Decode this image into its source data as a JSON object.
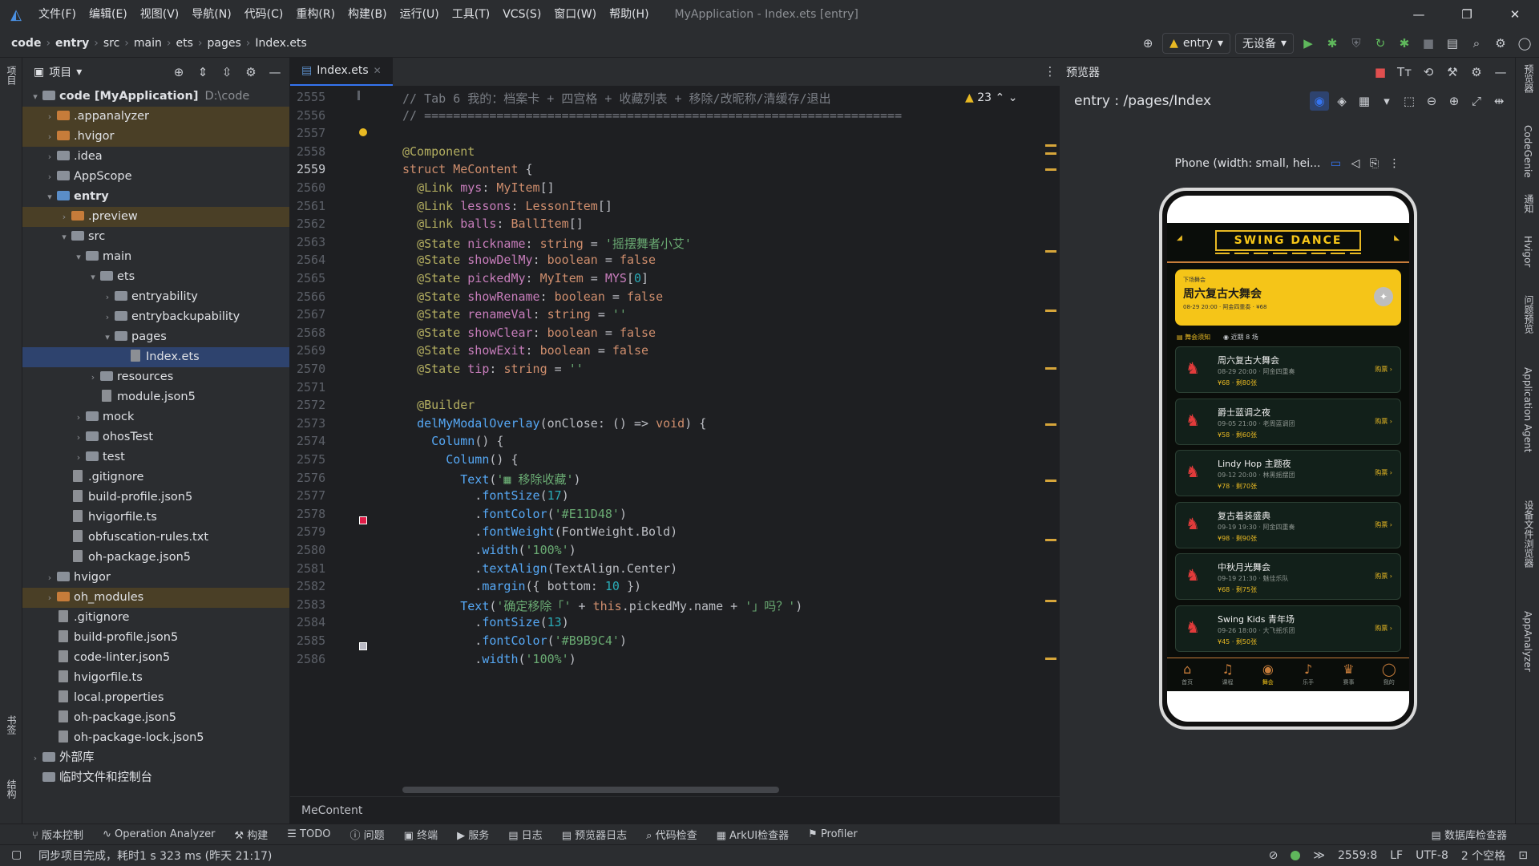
{
  "titlebar": {
    "menu": [
      "文件(F)",
      "编辑(E)",
      "视图(V)",
      "导航(N)",
      "代码(C)",
      "重构(R)",
      "构建(B)",
      "运行(U)",
      "工具(T)",
      "VCS(S)",
      "窗口(W)",
      "帮助(H)"
    ],
    "title": "MyApplication - Index.ets [entry]"
  },
  "nav": {
    "crumbs": [
      "code",
      "entry",
      "src",
      "main",
      "ets",
      "pages",
      "Index.ets"
    ],
    "module": "entry",
    "device": "无设备"
  },
  "leftstrip": {
    "project": "项目",
    "bookmarks": "书签",
    "structure": "结构"
  },
  "project": {
    "header": "项目",
    "tree": [
      {
        "d": 0,
        "arrow": "▾",
        "icon": "fold",
        "text": "code [MyApplication]",
        "extra": "D:\\code",
        "bold": true
      },
      {
        "d": 1,
        "arrow": "›",
        "icon": "or",
        "text": ".appanalyzer",
        "hl": true
      },
      {
        "d": 1,
        "arrow": "›",
        "icon": "or",
        "text": ".hvigor",
        "hl": true
      },
      {
        "d": 1,
        "arrow": "›",
        "icon": "fold",
        "text": ".idea"
      },
      {
        "d": 1,
        "arrow": "›",
        "icon": "fold",
        "text": "AppScope"
      },
      {
        "d": 1,
        "arrow": "▾",
        "icon": "bl",
        "text": "entry",
        "bold": true
      },
      {
        "d": 2,
        "arrow": "›",
        "icon": "or",
        "text": ".preview",
        "hl": true
      },
      {
        "d": 2,
        "arrow": "▾",
        "icon": "fold",
        "text": "src"
      },
      {
        "d": 3,
        "arrow": "▾",
        "icon": "fold",
        "text": "main"
      },
      {
        "d": 4,
        "arrow": "▾",
        "icon": "fold",
        "text": "ets"
      },
      {
        "d": 5,
        "arrow": "›",
        "icon": "fold",
        "text": "entryability"
      },
      {
        "d": 5,
        "arrow": "›",
        "icon": "fold",
        "text": "entrybackupability"
      },
      {
        "d": 5,
        "arrow": "▾",
        "icon": "fold",
        "text": "pages"
      },
      {
        "d": 6,
        "arrow": "",
        "icon": "file",
        "text": "Index.ets",
        "sel": true
      },
      {
        "d": 4,
        "arrow": "›",
        "icon": "fold",
        "text": "resources"
      },
      {
        "d": 4,
        "arrow": "",
        "icon": "file",
        "text": "module.json5"
      },
      {
        "d": 3,
        "arrow": "›",
        "icon": "fold",
        "text": "mock"
      },
      {
        "d": 3,
        "arrow": "›",
        "icon": "fold",
        "text": "ohosTest"
      },
      {
        "d": 3,
        "arrow": "›",
        "icon": "fold",
        "text": "test"
      },
      {
        "d": 2,
        "arrow": "",
        "icon": "file",
        "text": ".gitignore"
      },
      {
        "d": 2,
        "arrow": "",
        "icon": "file",
        "text": "build-profile.json5"
      },
      {
        "d": 2,
        "arrow": "",
        "icon": "file",
        "text": "hvigorfile.ts"
      },
      {
        "d": 2,
        "arrow": "",
        "icon": "file",
        "text": "obfuscation-rules.txt"
      },
      {
        "d": 2,
        "arrow": "",
        "icon": "file",
        "text": "oh-package.json5"
      },
      {
        "d": 1,
        "arrow": "›",
        "icon": "fold",
        "text": "hvigor"
      },
      {
        "d": 1,
        "arrow": "›",
        "icon": "or",
        "text": "oh_modules",
        "hl": true
      },
      {
        "d": 1,
        "arrow": "",
        "icon": "file",
        "text": ".gitignore"
      },
      {
        "d": 1,
        "arrow": "",
        "icon": "file",
        "text": "build-profile.json5"
      },
      {
        "d": 1,
        "arrow": "",
        "icon": "file",
        "text": "code-linter.json5"
      },
      {
        "d": 1,
        "arrow": "",
        "icon": "file",
        "text": "hvigorfile.ts"
      },
      {
        "d": 1,
        "arrow": "",
        "icon": "file",
        "text": "local.properties"
      },
      {
        "d": 1,
        "arrow": "",
        "icon": "file",
        "text": "oh-package.json5"
      },
      {
        "d": 1,
        "arrow": "",
        "icon": "file",
        "text": "oh-package-lock.json5"
      },
      {
        "d": 0,
        "arrow": "›",
        "icon": "fold",
        "text": "外部库"
      },
      {
        "d": 0,
        "arrow": "",
        "icon": "fold",
        "text": "临时文件和控制台"
      }
    ]
  },
  "editor": {
    "tab": "Index.ets",
    "warnings": "23",
    "current_line": "2559",
    "breadcrumb": "MeContent",
    "lines": [
      [
        "2555",
        "<span class='cm'>// Tab 6 我的：档案卡 + 四宫格 + 收藏列表 + 移除/改昵称/清缓存/退出</span>"
      ],
      [
        "2556",
        "<span class='cm'>// ==================================================================</span>"
      ],
      [
        "2557",
        ""
      ],
      [
        "2558",
        "<span class='a'>@Component</span>"
      ],
      [
        "2559",
        "<span class='k'>struct</span> <span class='ty'>MeContent</span> {"
      ],
      [
        "2560",
        "  <span class='a'>@Link</span> <span class='v'>mys</span>: <span class='ty'>MyItem</span>[]"
      ],
      [
        "2561",
        "  <span class='a'>@Link</span> <span class='v'>lessons</span>: <span class='ty'>LessonItem</span>[]"
      ],
      [
        "2562",
        "  <span class='a'>@Link</span> <span class='v'>balls</span>: <span class='ty'>BallItem</span>[]"
      ],
      [
        "2563",
        "  <span class='a'>@State</span> <span class='v'>nickname</span>: <span class='k'>string</span> = <span class='s'>'摇摆舞者小艾'</span>"
      ],
      [
        "2564",
        "  <span class='a'>@State</span> <span class='v'>showDelMy</span>: <span class='k'>boolean</span> = <span class='k'>false</span>"
      ],
      [
        "2565",
        "  <span class='a'>@State</span> <span class='v'>pickedMy</span>: <span class='ty'>MyItem</span> = <span class='v'>MYS</span>[<span class='n'>0</span>]"
      ],
      [
        "2566",
        "  <span class='a'>@State</span> <span class='v'>showRename</span>: <span class='k'>boolean</span> = <span class='k'>false</span>"
      ],
      [
        "2567",
        "  <span class='a'>@State</span> <span class='v'>renameVal</span>: <span class='k'>string</span> = <span class='s'>''</span>"
      ],
      [
        "2568",
        "  <span class='a'>@State</span> <span class='v'>showClear</span>: <span class='k'>boolean</span> = <span class='k'>false</span>"
      ],
      [
        "2569",
        "  <span class='a'>@State</span> <span class='v'>showExit</span>: <span class='k'>boolean</span> = <span class='k'>false</span>"
      ],
      [
        "2570",
        "  <span class='a'>@State</span> <span class='v'>tip</span>: <span class='k'>string</span> = <span class='s'>''</span>"
      ],
      [
        "2571",
        ""
      ],
      [
        "2572",
        "  <span class='a'>@Builder</span>"
      ],
      [
        "2573",
        "  <span class='f'>delMyModalOverlay</span>(onClose: () => <span class='k'>void</span>) {"
      ],
      [
        "2574",
        "    <span class='f'>Column</span>() {"
      ],
      [
        "2575",
        "      <span class='f'>Column</span>() {"
      ],
      [
        "2576",
        "        <span class='f'>Text</span>(<span class='s'>'▦ 移除收藏'</span>)"
      ],
      [
        "2577",
        "          .<span class='f'>fontSize</span>(<span class='n'>17</span>)"
      ],
      [
        "2578",
        "          .<span class='f'>fontColor</span>(<span class='s'>'#E11D48'</span>)"
      ],
      [
        "2579",
        "          .<span class='f'>fontWeight</span>(FontWeight.Bold)"
      ],
      [
        "2580",
        "          .<span class='f'>width</span>(<span class='s'>'100%'</span>)"
      ],
      [
        "2581",
        "          .<span class='f'>textAlign</span>(TextAlign.Center)"
      ],
      [
        "2582",
        "          .<span class='f'>margin</span>({ bottom: <span class='n'>10</span> })"
      ],
      [
        "2583",
        "        <span class='f'>Text</span>(<span class='s'>'确定移除「'</span> + <span class='k'>this</span>.pickedMy.name + <span class='s'>'」吗？'</span>)"
      ],
      [
        "2584",
        "          .<span class='f'>fontSize</span>(<span class='n'>13</span>)"
      ],
      [
        "2585",
        "          .<span class='f'>fontColor</span>(<span class='s'>'#B9B9C4'</span>)"
      ],
      [
        "2586",
        "          .<span class='f'>width</span>(<span class='s'>'100%'</span>)"
      ]
    ]
  },
  "preview": {
    "header": "预览器",
    "route": "entry : /pages/Index",
    "device": "Phone (width: small, hei...",
    "app": {
      "banner": "SWING DANCE",
      "hero_small": "下场舞会",
      "hero_title": "周六复古大舞会",
      "hero_meta": "08-29 20:00 · 阿金四重奏 · ¥68",
      "section_left": "舞会须知",
      "section_right": "近期 8 场",
      "events": [
        {
          "title": "周六复古大舞会",
          "meta": "08-29 20:00 · 阿金四重奏",
          "price": "¥68 · 剩80张",
          "buy": "购票 ›"
        },
        {
          "title": "爵士蓝调之夜",
          "meta": "09-05 21:00 · 老周蓝调团",
          "price": "¥58 · 剩60张",
          "buy": "购票 ›"
        },
        {
          "title": "Lindy Hop 主题夜",
          "meta": "09-12 20:00 · 林黑摇摆团",
          "price": "¥78 · 剩70张",
          "buy": "购票 ›"
        },
        {
          "title": "复古着装盛典",
          "meta": "09-19 19:30 · 阿金四重奏",
          "price": "¥98 · 剩90张",
          "buy": "购票 ›"
        },
        {
          "title": "中秋月光舞会",
          "meta": "09-19 21:30 · 魅佳乐队",
          "price": "¥68 · 剩75张",
          "buy": "购票 ›"
        },
        {
          "title": "Swing Kids 青年场",
          "meta": "09-26 18:00 · 大飞摇乐团",
          "price": "¥45 · 剩50张",
          "buy": "购票 ›"
        }
      ],
      "tabs": [
        "首页",
        "课程",
        "舞会",
        "乐手",
        "赛事",
        "我的"
      ],
      "active_tab": "舞会"
    }
  },
  "rightstrip": [
    "预览器",
    "CodeGenie",
    "通知",
    "Hvigor",
    "问题预览",
    "Application Agent",
    "设备文件浏览器",
    "AppAnalyzer"
  ],
  "bottom_tools": [
    "版本控制",
    "Operation Analyzer",
    "构建",
    "TODO",
    "问题",
    "终端",
    "服务",
    "日志",
    "预览器日志",
    "代码检查",
    "ArkUI检查器",
    "Profiler",
    "数据库检查器"
  ],
  "status": {
    "message": "同步项目完成，耗时1 s 323 ms (昨天 21:17)",
    "position": "2559:8",
    "line_sep": "LF",
    "encoding": "UTF-8",
    "indent": "2 个空格"
  },
  "colors": {
    "accent": "#3574f0",
    "brand_yellow": "#f5c518",
    "dancer_red": "#e23b3b"
  }
}
